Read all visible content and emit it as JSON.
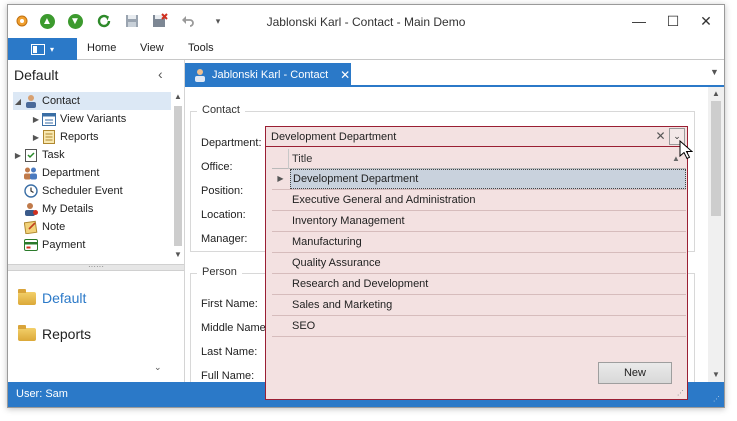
{
  "window": {
    "title": "Jablonski Karl - Contact - Main Demo",
    "minimize_glyph": "—",
    "maximize_glyph": "☐",
    "close_glyph": "✕"
  },
  "quick_access": [
    {
      "icon": "gear-app-icon"
    },
    {
      "icon": "arrow-up-icon"
    },
    {
      "icon": "arrow-down-icon"
    },
    {
      "icon": "refresh-icon"
    },
    {
      "icon": "save-icon"
    },
    {
      "icon": "save-and-close-icon"
    },
    {
      "icon": "undo-icon"
    },
    {
      "icon": "customize-toolbar-icon"
    }
  ],
  "ribbon": {
    "tabs": [
      "Home",
      "View",
      "Tools"
    ]
  },
  "navigation": {
    "header": "Default",
    "tree": [
      {
        "label": "Contact",
        "icon": "contact-icon",
        "expand": "◢",
        "selected": true
      },
      {
        "label": "View Variants",
        "icon": "view-variants-icon",
        "expand": "▶"
      },
      {
        "label": "Reports",
        "icon": "reports-icon",
        "expand": "▶"
      },
      {
        "label": "Task",
        "icon": "task-icon",
        "expand": "▶"
      },
      {
        "label": "Department",
        "icon": "department-icon",
        "expand": ""
      },
      {
        "label": "Scheduler Event",
        "icon": "scheduler-event-icon",
        "expand": ""
      },
      {
        "label": "My Details",
        "icon": "my-details-icon",
        "expand": ""
      },
      {
        "label": "Note",
        "icon": "note-icon",
        "expand": ""
      },
      {
        "label": "Payment",
        "icon": "payment-icon",
        "expand": ""
      }
    ],
    "groups": [
      {
        "label": "Default",
        "active": true
      },
      {
        "label": "Reports",
        "active": false
      }
    ]
  },
  "document_tab": {
    "label": "Jablonski Karl - Contact"
  },
  "form": {
    "contact_group": "Contact",
    "contact_fields": [
      "Department:",
      "Office:",
      "Position:",
      "Location:",
      "Manager:"
    ],
    "person_group": "Person",
    "person_fields": [
      "First Name:",
      "Middle Name:",
      "Last Name:",
      "Full Name:"
    ]
  },
  "lookup": {
    "value": "Development Department",
    "column_title": "Title",
    "rows": [
      "Development Department",
      "Executive General and Administration",
      "Inventory Management",
      "Manufacturing",
      "Quality Assurance",
      "Research and Development",
      "Sales and Marketing",
      "SEO"
    ],
    "focused_index": 0,
    "new_button": "New"
  },
  "status": {
    "user": "User: Sam"
  },
  "colors": {
    "accent": "#2b79c8",
    "editor_border": "#9a1f33",
    "editor_background": "#f3e1e1"
  }
}
